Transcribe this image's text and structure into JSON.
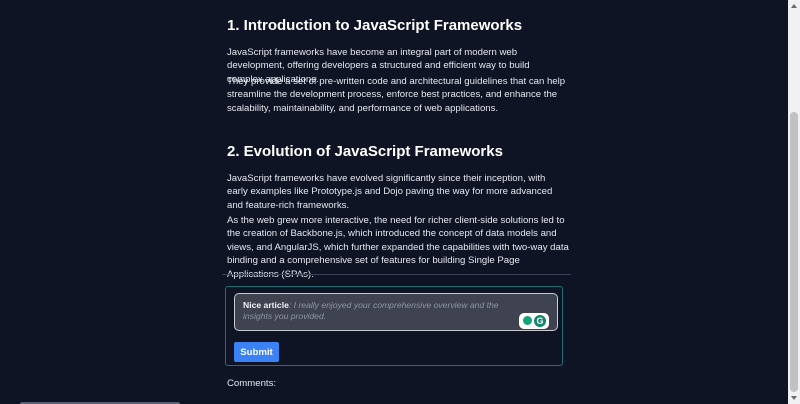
{
  "article": {
    "section1": {
      "heading": "1. Introduction to JavaScript Frameworks",
      "paragraphs": [
        "JavaScript frameworks have become an integral part of modern web development, offering developers a structured and efficient way to build complex applications.",
        "They provide a set of pre-written code and architectural guidelines that can help streamline the development process, enforce best practices, and enhance the scalability, maintainability, and performance of web applications."
      ]
    },
    "section2": {
      "heading": "2. Evolution of JavaScript Frameworks",
      "paragraphs": [
        "JavaScript frameworks have evolved significantly since their inception, with early examples like Prototype.js and Dojo paving the way for more advanced and feature-rich frameworks.",
        "As the web grew more interactive, the need for richer client-side solutions led to the creation of Backbone.js, which introduced the concept of data models and views, and AngularJS, which further expanded the capabilities with two-way data binding and a comprehensive set of features for building Single Page Applications (SPAs)."
      ]
    }
  },
  "comment_form": {
    "typed_text": "Nice article",
    "placeholder": ": I really enjoyed your comprehensive overview and the insights you provided.",
    "submit_label": "Submit",
    "extension_icon": "grammarly-icon"
  },
  "comments": {
    "label": "Comments:"
  },
  "colors": {
    "background": "#0f1424",
    "accent": "#3b82f6",
    "form_border": "#1e6f78"
  }
}
